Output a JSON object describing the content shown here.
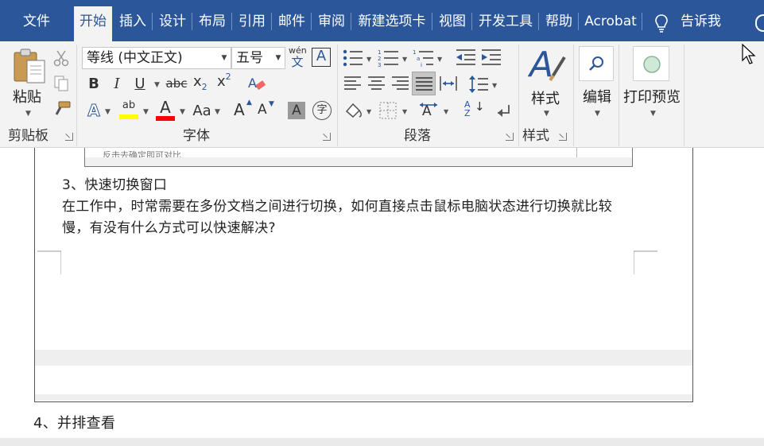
{
  "menu": {
    "tabs": [
      "文件",
      "开始",
      "插入",
      "设计",
      "布局",
      "引用",
      "邮件",
      "审阅",
      "新建选项卡",
      "视图",
      "开发工具",
      "帮助",
      "Acrobat"
    ],
    "active_tab": "开始",
    "tell_me": "告诉我"
  },
  "clipboard": {
    "paste_label": "粘贴",
    "group_label": "剪贴板"
  },
  "font": {
    "font_name": "等线 (中文正文)",
    "font_size": "五号",
    "phonetic_top": "wén",
    "phonetic_bottom": "文",
    "border_char": "A",
    "bold": "B",
    "italic": "I",
    "underline": "U",
    "strikethrough": "abc",
    "subscript_base": "x",
    "subscript_mark": "2",
    "superscript_base": "x",
    "superscript_mark": "2",
    "text_effects": "A",
    "highlight_text": "ab",
    "font_color_text": "A",
    "change_case": "Aa",
    "grow_font": "A",
    "shrink_font": "A",
    "char_shading": "A",
    "enclose_char": "字",
    "group_label": "字体",
    "highlight_color": "#ffff00",
    "font_color": "#ff0000"
  },
  "paragraph": {
    "group_label": "段落",
    "sort_label": "A↓Z"
  },
  "styles": {
    "styles_label": "样式",
    "group_label": "样式"
  },
  "editing": {
    "edit_label": "编辑"
  },
  "print": {
    "print_preview_label": "打印预览"
  },
  "document": {
    "faded_text": "反击去确定即可对比",
    "heading3": "3、快速切换窗口",
    "body_line1": "在工作中，时常需要在多份文档之间进行切换，如何直接点击鼠标电脑状态进行切换就比较",
    "body_line2": "慢，有没有什么方式可以快速解决?",
    "heading4": "4、并排查看"
  },
  "colors": {
    "title_bar": "#2b579a",
    "ribbon_bg": "#f3f3f3",
    "accent_blue": "#2b579a"
  }
}
